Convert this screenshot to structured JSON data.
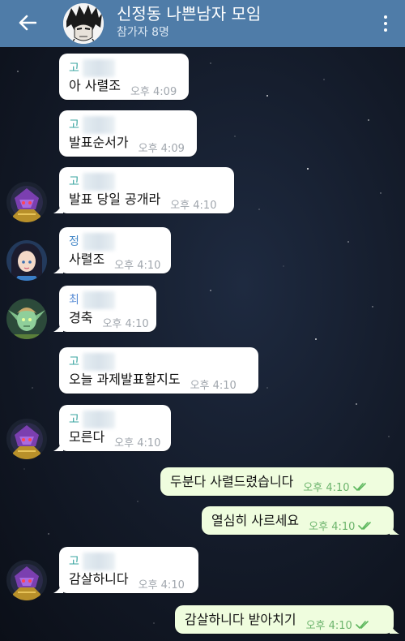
{
  "header": {
    "title": "신정동 나쁜남자 모임",
    "subtitle": "참가자 8명"
  },
  "messages": [
    {
      "sender": "고",
      "text": "아 사렬조",
      "time": "오후 4:09"
    },
    {
      "sender": "고",
      "text": "발표순서가",
      "time": "오후 4:09"
    },
    {
      "sender": "고",
      "text": "발표 당일 공개라",
      "time": "오후 4:10"
    },
    {
      "sender": "정",
      "text": "사렬조",
      "time": "오후 4:10"
    },
    {
      "sender": "최",
      "text": "경축",
      "time": "오후 4:10"
    },
    {
      "sender": "고",
      "text": "오늘 과제발표할지도",
      "time": "오후 4:10"
    },
    {
      "sender": "고",
      "text": "모른다",
      "time": "오후 4:10"
    },
    {
      "text": "두분다 사렬드렸습니다",
      "time": "오후 4:10"
    },
    {
      "text": "열심히 사르세요",
      "time": "오후 4:10"
    },
    {
      "sender": "고",
      "text": "감살하니다",
      "time": "오후 4:10"
    },
    {
      "text": "감살하니다 받아치기",
      "time": "오후 4:10"
    }
  ],
  "icons": {
    "back": "arrow-left-icon",
    "menu": "more-vertical-icon",
    "read": "double-check-icon"
  },
  "colors": {
    "header": "#4f7ca8",
    "sender_go": "#3aa5a0",
    "sender_jeong": "#4a8bc9",
    "sender_choi": "#5b8ed6",
    "outgoing_bubble": "#effdde",
    "read_check": "#5fb85f"
  }
}
